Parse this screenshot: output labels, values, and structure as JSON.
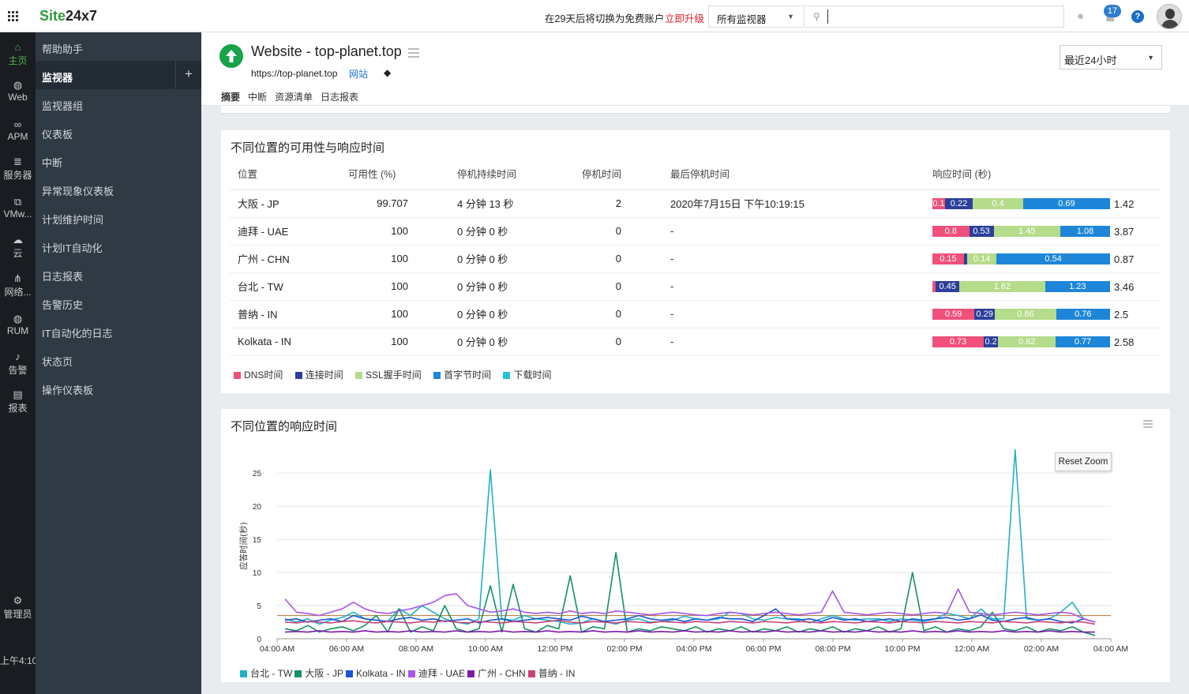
{
  "topbar": {
    "logo_a": "Site",
    "logo_b": "24x7",
    "trial_text": "在29天后将切换为免费账户",
    "upgrade_label": "立即升级",
    "monitor_select": "所有监视器",
    "notification_count": "17",
    "help_label": "?"
  },
  "rail": {
    "items": [
      {
        "label": "主页",
        "icon": "home-icon"
      },
      {
        "label": "Web",
        "icon": "globe-icon"
      },
      {
        "label": "APM",
        "icon": "binoculars-icon"
      },
      {
        "label": "服务器",
        "icon": "server-icon"
      },
      {
        "label": "VMw...",
        "icon": "vm-icon"
      },
      {
        "label": "云",
        "icon": "cloud-icon"
      },
      {
        "label": "网络...",
        "icon": "network-icon"
      },
      {
        "label": "RUM",
        "icon": "rum-icon"
      },
      {
        "label": "告警",
        "icon": "bell-icon"
      },
      {
        "label": "报表",
        "icon": "report-icon"
      },
      {
        "label": "管理员",
        "icon": "gear-icon"
      }
    ],
    "time": "上午4:10"
  },
  "sidebar": {
    "items": [
      {
        "label": "帮助助手"
      },
      {
        "label": "监视器"
      },
      {
        "label": "监视器组"
      },
      {
        "label": "仪表板"
      },
      {
        "label": "中断"
      },
      {
        "label": "异常现象仪表板"
      },
      {
        "label": "计划维护时间"
      },
      {
        "label": "计划IT自动化"
      },
      {
        "label": "日志报表"
      },
      {
        "label": "告警历史"
      },
      {
        "label": "IT自动化的日志"
      },
      {
        "label": "状态页"
      },
      {
        "label": "操作仪表板"
      }
    ],
    "add_label": "+"
  },
  "monitor": {
    "title": "Website - top-planet.top",
    "url": "https://top-planet.top",
    "type": "网站",
    "tabs": [
      "摘要",
      "中断",
      "资源清单",
      "日志报表"
    ],
    "period": "最近24小时"
  },
  "availability": {
    "title": "不同位置的可用性与响应时间",
    "headers": [
      "位置",
      "可用性 (%)",
      "停机持续时间",
      "停机时间",
      "最后停机时间",
      "响应时间 (秒)"
    ],
    "rows": [
      {
        "location": "大阪 - JP",
        "availability": "99.707",
        "downtime_duration": "4 分钟 13 秒",
        "downs": "2",
        "last_down": "2020年7月15日 下午10:19:15",
        "segments": [
          "0.1",
          "0.22",
          "0.4",
          "0.69"
        ],
        "total": "1.42"
      },
      {
        "location": "迪拜 - UAE",
        "availability": "100",
        "downtime_duration": "0 分钟 0 秒",
        "downs": "0",
        "last_down": "-",
        "segments": [
          "0.8",
          "0.53",
          "1.45",
          "1.08"
        ],
        "total": "3.87"
      },
      {
        "location": "广州 - CHN",
        "availability": "100",
        "downtime_duration": "0 分钟 0 秒",
        "downs": "0",
        "last_down": "-",
        "segments": [
          "0.15",
          "",
          "0.14",
          "0.54"
        ],
        "total": "0.87"
      },
      {
        "location": "台北 - TW",
        "availability": "100",
        "downtime_duration": "0 分钟 0 秒",
        "downs": "0",
        "last_down": "-",
        "segments": [
          "",
          "0.45",
          "1.62",
          "1.23"
        ],
        "total": "3.46"
      },
      {
        "location": "普纳 - IN",
        "availability": "100",
        "downtime_duration": "0 分钟 0 秒",
        "downs": "0",
        "last_down": "-",
        "segments": [
          "0.59",
          "0.29",
          "0.86",
          "0.76"
        ],
        "total": "2.5"
      },
      {
        "location": "Kolkata - IN",
        "availability": "100",
        "downtime_duration": "0 分钟 0 秒",
        "downs": "0",
        "last_down": "-",
        "segments": [
          "0.73",
          "0.2",
          "0.82",
          "0.77"
        ],
        "total": "2.58"
      }
    ],
    "legend": [
      {
        "label": "DNS时间",
        "color": "#f0507a"
      },
      {
        "label": "连接时间",
        "color": "#2b3f9a"
      },
      {
        "label": "SSL握手时间",
        "color": "#b5dc8a"
      },
      {
        "label": "首字节时间",
        "color": "#1d86d8"
      },
      {
        "label": "下载时间",
        "color": "#22c3d6"
      }
    ]
  },
  "response_chart": {
    "title": "不同位置的响应时间",
    "reset_zoom": "Reset Zoom"
  },
  "chart_data": {
    "type": "line",
    "ylabel": "应答时间(秒)",
    "ylim": [
      0,
      28
    ],
    "yticks": [
      "0",
      "5",
      "10",
      "15",
      "20",
      "25"
    ],
    "xticks": [
      "04:00 AM",
      "06:00 AM",
      "08:00 AM",
      "10:00 AM",
      "12:00 PM",
      "02:00 PM",
      "04:00 PM",
      "06:00 PM",
      "08:00 PM",
      "10:00 PM",
      "12:00 AM",
      "02:00 AM",
      "04:00 AM"
    ],
    "threshold": 3.5,
    "threshold_color": "#b07030",
    "series": [
      {
        "name": "台北 - TW",
        "color": "#22b0c8",
        "values": [
          3,
          2.5,
          3,
          2.2,
          2.8,
          3.2,
          4,
          3,
          2.8,
          2.6,
          4.5,
          3.5,
          5,
          4,
          3,
          2.5,
          2.2,
          3,
          25.5,
          3,
          2.8,
          3.5,
          3,
          2.8,
          2.6,
          2.2,
          2.4,
          3,
          2.6,
          2.2,
          2.8,
          3,
          2.5,
          2.6,
          2.8,
          3.4,
          3,
          2.8,
          3,
          4,
          3.8,
          3,
          2.8,
          3.2,
          3,
          3,
          2.4,
          3,
          3.5,
          3,
          2.8,
          3,
          3,
          2.6,
          3,
          2.8,
          2.6,
          3,
          3.8,
          3.5,
          3,
          4.5,
          3,
          3,
          28.5,
          3,
          2.8,
          3,
          4,
          5.5,
          3,
          2.5
        ]
      },
      {
        "name": "大阪 - JP",
        "color": "#14906a",
        "values": [
          1.5,
          1.2,
          2,
          1,
          1.5,
          1.8,
          1.2,
          2,
          3.5,
          1,
          4.5,
          1,
          1.8,
          1.2,
          5,
          1.5,
          1,
          1.5,
          8,
          1,
          8.2,
          1.5,
          1,
          2,
          1.5,
          9.5,
          1,
          1.8,
          1.5,
          13,
          1,
          1.5,
          1.2,
          1.8,
          1.5,
          1.2,
          1.8,
          1,
          1.5,
          1.2,
          1.8,
          1,
          1.5,
          1.2,
          1.8,
          1,
          1.5,
          1.2,
          1.8,
          1,
          1.5,
          1.2,
          1.8,
          1,
          1.5,
          10,
          1.2,
          1.8,
          1,
          1.5,
          1.2,
          1.8,
          4,
          1.5,
          1.2,
          1.8,
          1,
          1.5,
          1.2,
          1.8,
          1,
          0.5
        ]
      },
      {
        "name": "Kolkata - IN",
        "color": "#1a56d6",
        "values": [
          2.8,
          3,
          2.5,
          2.8,
          3,
          2.6,
          3.5,
          3,
          2.8,
          2.6,
          3,
          3.2,
          2.8,
          3,
          2.6,
          2.8,
          3,
          2.4,
          2.8,
          3,
          2.6,
          2.8,
          3,
          3.2,
          3,
          2.8,
          3.4,
          3,
          2.6,
          2.8,
          3,
          3.5,
          3,
          2.8,
          3,
          2.6,
          3,
          2.8,
          3.2,
          3,
          3,
          2.6,
          3.5,
          4.5,
          3,
          2.8,
          3,
          2.6,
          3.2,
          2.8,
          3,
          2.6,
          2.8,
          3,
          2.6,
          3,
          2.8,
          3,
          3.2,
          2.8,
          3,
          3.6,
          2.8,
          2.6,
          3,
          3.2,
          2.8,
          3,
          2.6,
          2.4,
          3,
          2.5
        ]
      },
      {
        "name": "迪拜 - UAE",
        "color": "#a855e8",
        "values": [
          6,
          4,
          3.8,
          3.5,
          4,
          4.5,
          5.5,
          4.5,
          4,
          3.8,
          4.2,
          4.5,
          5,
          5.5,
          6.5,
          6.8,
          5,
          4.5,
          4,
          4.2,
          4.5,
          4,
          3.8,
          4,
          3.8,
          4.2,
          3.8,
          4,
          3.8,
          4.2,
          4,
          3.8,
          3.6,
          3.8,
          4,
          3.8,
          3.6,
          3.5,
          3.8,
          4,
          3.8,
          3.6,
          3.8,
          4,
          3.8,
          3.6,
          3.8,
          4,
          7.2,
          4,
          3.8,
          3.6,
          3.8,
          4,
          3.8,
          3.6,
          3.8,
          4,
          3.8,
          7.5,
          4,
          3.8,
          3.6,
          3.8,
          4,
          3.8,
          3.6,
          3.8,
          4,
          3.8,
          3,
          2.5
        ]
      },
      {
        "name": "广州 - CHN",
        "color": "#7e1aa8",
        "values": [
          1,
          1.1,
          1,
          1.2,
          1,
          1.1,
          1,
          1.2,
          1,
          1.1,
          1,
          1.2,
          1,
          1.1,
          1,
          1.2,
          1,
          1.1,
          1,
          1.2,
          1,
          1.1,
          1,
          1.2,
          1,
          1.1,
          1,
          1.2,
          1,
          1.1,
          1,
          1.2,
          1,
          1.1,
          1,
          1.2,
          1,
          1.1,
          1,
          1.2,
          1,
          1.1,
          1,
          1.2,
          1,
          1.1,
          1,
          1.2,
          1,
          1.1,
          1,
          1.2,
          1,
          1.1,
          1,
          1.2,
          1,
          1.1,
          1,
          1.2,
          1,
          1.1,
          1,
          1.2,
          1,
          1.1,
          1,
          1.2,
          1,
          1.1,
          1,
          1
        ]
      },
      {
        "name": "普纳 - IN",
        "color": "#c8407a",
        "values": [
          2.5,
          2.4,
          2.6,
          2.5,
          2.4,
          2.6,
          2.7,
          2.5,
          2.4,
          2.6,
          2.5,
          2.4,
          2.6,
          2.5,
          2.7,
          2.5,
          2.4,
          2.6,
          2.5,
          2.4,
          2.6,
          2.5,
          2.4,
          2.6,
          2.8,
          2.5,
          2.4,
          2.6,
          2.5,
          2.4,
          2.6,
          2.5,
          2.4,
          2.6,
          2.5,
          2.4,
          2.6,
          2.5,
          2.4,
          2.6,
          2.5,
          2.4,
          2.6,
          2.5,
          2.4,
          2.6,
          2.5,
          2.4,
          2.6,
          2.5,
          2.4,
          2.6,
          2.5,
          2.4,
          2.6,
          2.5,
          2.4,
          2.6,
          2.5,
          2.4,
          2.6,
          2.5,
          2.4,
          2.6,
          2.5,
          2.4,
          2.6,
          2.5,
          2.4,
          2.6,
          2.5,
          2.2
        ]
      }
    ]
  }
}
